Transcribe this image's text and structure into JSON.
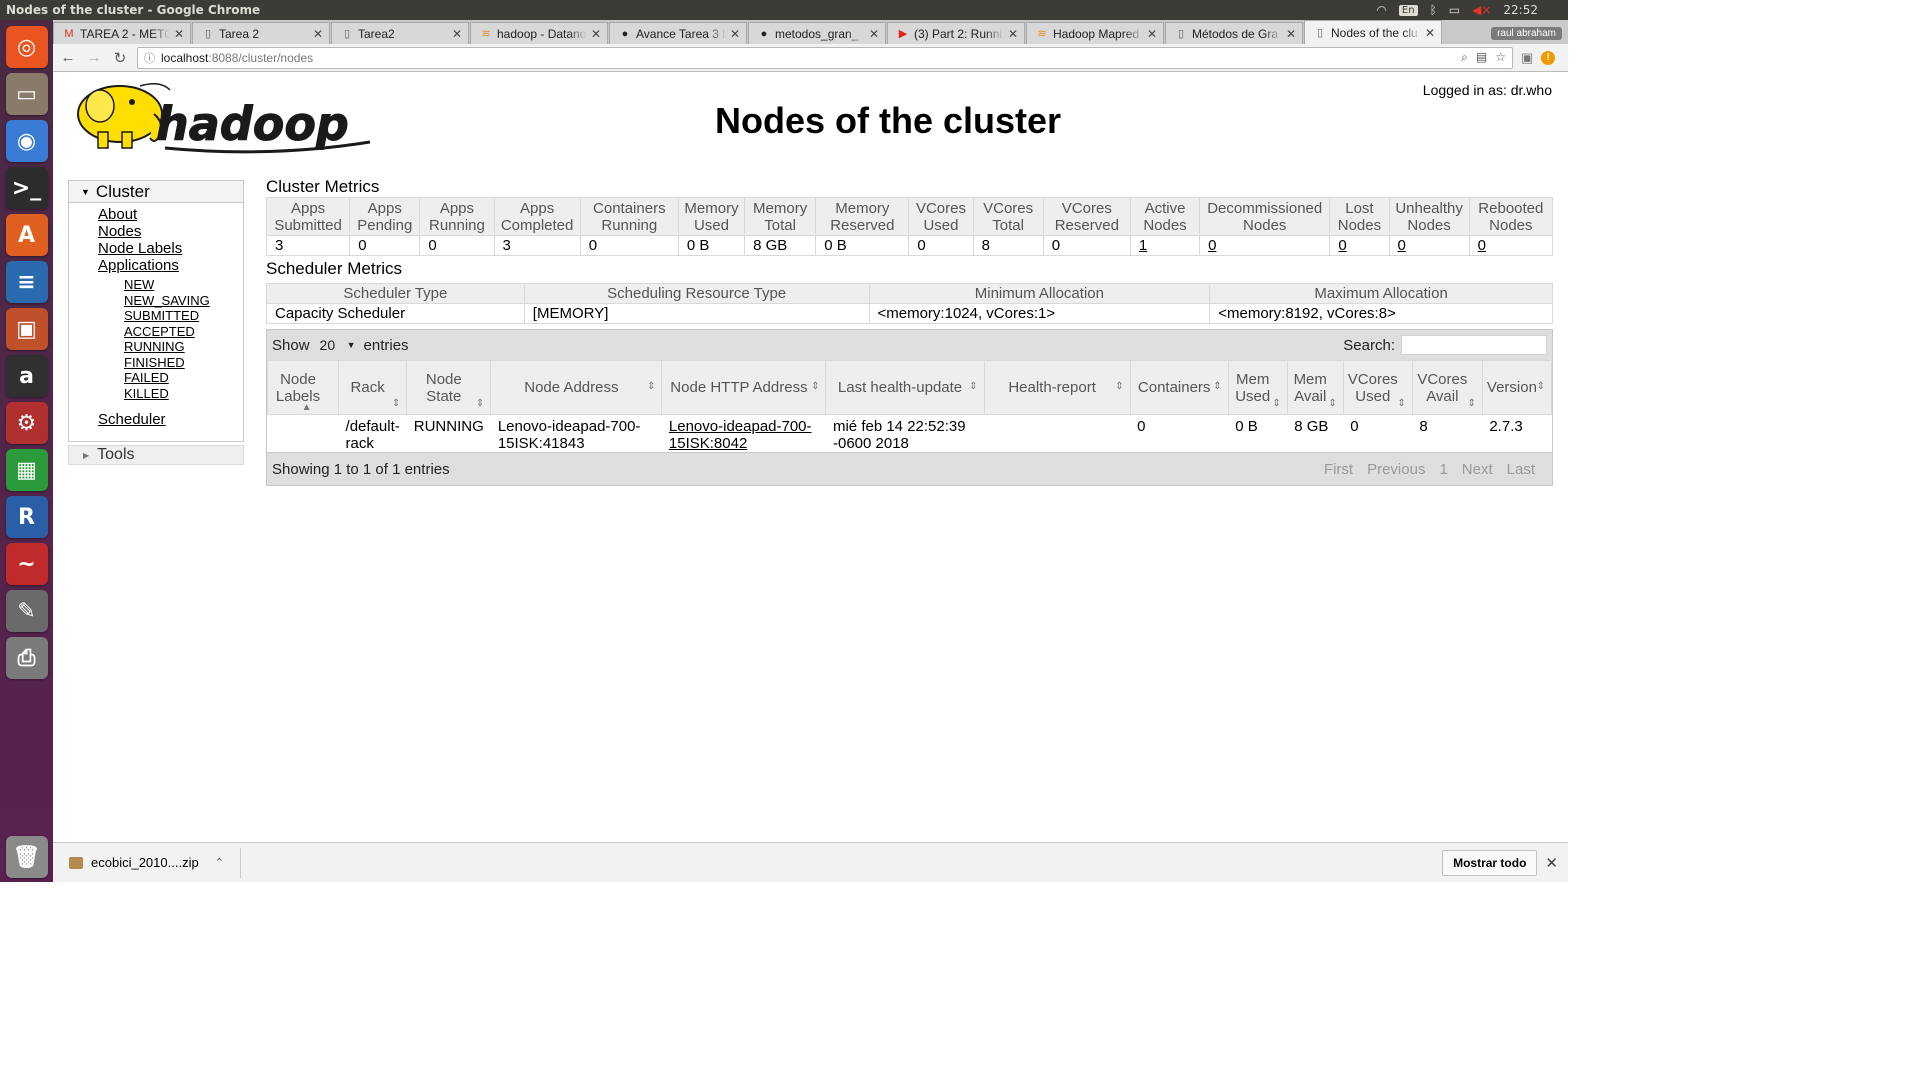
{
  "os": {
    "window_title": "Nodes of the cluster - Google Chrome",
    "keyboard": "En",
    "clock": "22:52"
  },
  "colors": {
    "hadoop_yellow": "#ffde00",
    "launcher": "#5e2750",
    "chrome_active_tab": "#f2f2f2"
  },
  "launcher": {
    "apps": [
      {
        "name": "ubuntu-dash-icon",
        "glyph": "◎",
        "color": "#e95420"
      },
      {
        "name": "files-icon",
        "glyph": "▭",
        "color": "#8a7a6a"
      },
      {
        "name": "chrome-icon",
        "glyph": "◉",
        "color": "#3a7bd5"
      },
      {
        "name": "terminal-icon",
        "glyph": ">_",
        "color": "#2c2c2c"
      },
      {
        "name": "software-center-icon",
        "glyph": "A",
        "color": "#e06020"
      },
      {
        "name": "writer-icon",
        "glyph": "≡",
        "color": "#2a6bb0"
      },
      {
        "name": "impress-icon",
        "glyph": "▣",
        "color": "#c0502a"
      },
      {
        "name": "amazon-icon",
        "glyph": "a",
        "color": "#303030"
      },
      {
        "name": "settings-icon",
        "glyph": "⚙",
        "color": "#b03030"
      },
      {
        "name": "calc-icon",
        "glyph": "▦",
        "color": "#2a9a3a"
      },
      {
        "name": "r-icon",
        "glyph": "R",
        "color": "#2a5fa8"
      },
      {
        "name": "evince-icon",
        "glyph": "~",
        "color": "#c02a2a"
      },
      {
        "name": "text-editor-icon",
        "glyph": "✎",
        "color": "#6a6a6a"
      },
      {
        "name": "printer-icon",
        "glyph": "⎙",
        "color": "#7a7a7a"
      }
    ],
    "trash": {
      "name": "trash-icon",
      "glyph": "🗑",
      "color": "#8a8a8a"
    }
  },
  "browser": {
    "tabs": [
      {
        "icon": "M",
        "icon_color": "#d93025",
        "title": "TAREA 2 - METO",
        "active": false
      },
      {
        "icon": "▯",
        "icon_color": "#666666",
        "title": "Tarea 2",
        "active": false
      },
      {
        "icon": "▯",
        "icon_color": "#666666",
        "title": "Tarea2",
        "active": false
      },
      {
        "icon": "≋",
        "icon_color": "#e08a2a",
        "title": "hadoop - Datano",
        "active": false
      },
      {
        "icon": "●",
        "icon_color": "#222222",
        "title": "Avance Tarea 3 b",
        "active": false
      },
      {
        "icon": "●",
        "icon_color": "#222222",
        "title": "metodos_gran_",
        "active": false
      },
      {
        "icon": "▶",
        "icon_color": "#e62117",
        "title": "(3) Part 2: Runni",
        "active": false
      },
      {
        "icon": "≋",
        "icon_color": "#e08a2a",
        "title": "Hadoop Mapred",
        "active": false
      },
      {
        "icon": "▯",
        "icon_color": "#666666",
        "title": "Métodos de Gra",
        "active": false
      },
      {
        "icon": "▯",
        "icon_color": "#666666",
        "title": "Nodes of the clu",
        "active": true
      }
    ],
    "profile": "raul abraham",
    "url_host": "localhost",
    "url_rest": ":8088/cluster/nodes"
  },
  "page": {
    "title": "Nodes of the cluster",
    "logged_in": "Logged in as: dr.who",
    "logo_text": "hadoop"
  },
  "nav": {
    "cluster_label": "Cluster",
    "items": [
      "About",
      "Nodes",
      "Node Labels",
      "Applications"
    ],
    "app_states": [
      "NEW",
      "NEW_SAVING",
      "SUBMITTED",
      "ACCEPTED",
      "RUNNING",
      "FINISHED",
      "FAILED",
      "KILLED"
    ],
    "scheduler": "Scheduler",
    "tools_label": "Tools"
  },
  "cluster_metrics": {
    "title": "Cluster Metrics",
    "headers": [
      [
        "Apps",
        "Submitted"
      ],
      [
        "Apps",
        "Pending"
      ],
      [
        "Apps",
        "Running"
      ],
      [
        "Apps",
        "Completed"
      ],
      [
        "Containers",
        "Running"
      ],
      [
        "Memory",
        "Used"
      ],
      [
        "Memory",
        "Total"
      ],
      [
        "Memory",
        "Reserved"
      ],
      [
        "VCores",
        "Used"
      ],
      [
        "VCores",
        "Total"
      ],
      [
        "VCores",
        "Reserved"
      ],
      [
        "Active",
        "Nodes"
      ],
      [
        "Decommissioned",
        "Nodes"
      ],
      [
        "Lost",
        "Nodes"
      ],
      [
        "Unhealthy",
        "Nodes"
      ],
      [
        "Rebooted",
        "Nodes"
      ]
    ],
    "values": [
      "3",
      "0",
      "0",
      "3",
      "0",
      "0 B",
      "8 GB",
      "0 B",
      "0",
      "8",
      "0",
      "1",
      "0",
      "0",
      "0",
      "0"
    ],
    "links": [
      false,
      false,
      false,
      false,
      false,
      false,
      false,
      false,
      false,
      false,
      false,
      true,
      true,
      true,
      true,
      true
    ]
  },
  "scheduler_metrics": {
    "title": "Scheduler Metrics",
    "headers": [
      "Scheduler Type",
      "Scheduling Resource Type",
      "Minimum Allocation",
      "Maximum Allocation"
    ],
    "values": [
      "Capacity Scheduler",
      "[MEMORY]",
      "<memory:1024, vCores:1>",
      "<memory:8192, vCores:8>"
    ]
  },
  "nodes_table": {
    "show_label": "Show",
    "page_length": "20",
    "entries_label": "entries",
    "search_label": "Search:",
    "headers": [
      [
        "Node",
        "Labels"
      ],
      [
        "Rack"
      ],
      [
        "Node",
        "State"
      ],
      [
        "Node Address"
      ],
      [
        "Node HTTP Address"
      ],
      [
        "Last health-update"
      ],
      [
        "Health-report"
      ],
      [
        "Containers"
      ],
      [
        "Mem",
        "Used"
      ],
      [
        "Mem",
        "Avail"
      ],
      [
        "VCores",
        "Used"
      ],
      [
        "VCores",
        "Avail"
      ],
      [
        "Version"
      ]
    ],
    "rows": [
      {
        "labels": "",
        "rack": [
          "/default-",
          "rack"
        ],
        "state": "RUNNING",
        "address": [
          "Lenovo-ideapad-700-",
          "15ISK:41843"
        ],
        "http_address": [
          "Lenovo-ideapad-700-",
          "15ISK:8042"
        ],
        "last_health": [
          "mié feb 14 22:52:39",
          "-0600 2018"
        ],
        "health_report": "",
        "containers": "0",
        "mem_used": "0 B",
        "mem_avail": "8 GB",
        "vcores_used": "0",
        "vcores_avail": "8",
        "version": "2.7.3"
      }
    ],
    "info": "Showing 1 to 1 of 1 entries",
    "pager": [
      "First",
      "Previous",
      "1",
      "Next",
      "Last"
    ]
  },
  "downloads": {
    "file": "ecobici_2010....zip",
    "show_all": "Mostrar todo"
  }
}
